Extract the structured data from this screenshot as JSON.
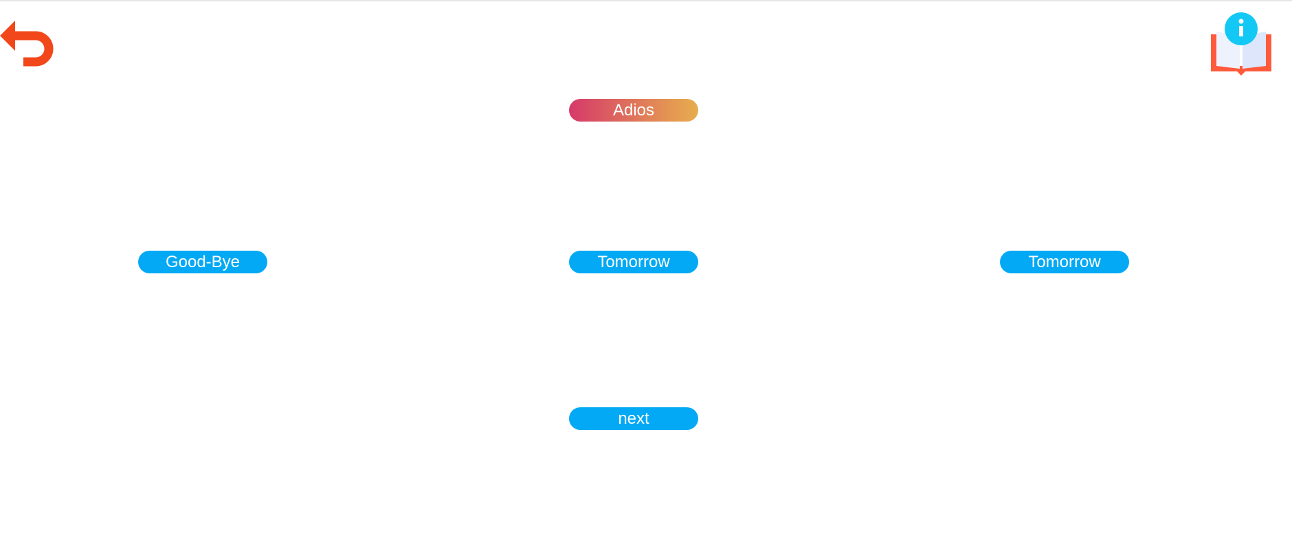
{
  "icons": {
    "back": "back-arrow-icon",
    "info": "info-book-icon",
    "info_glyph": "i"
  },
  "colors": {
    "back_icon": "#f2471a",
    "pill_blue": "#03a9f4",
    "highlight_start": "#d6396a",
    "highlight_end": "#e6ad4e",
    "info_circle": "#14c8f5",
    "book_cover": "#ff5a3c",
    "book_pages": "#dde6fb"
  },
  "prompt": {
    "word": "Adios"
  },
  "choices": [
    {
      "label": "Good-Bye"
    },
    {
      "label": "Tomorrow"
    },
    {
      "label": "Tomorrow"
    }
  ],
  "next_button": {
    "label": "next"
  }
}
